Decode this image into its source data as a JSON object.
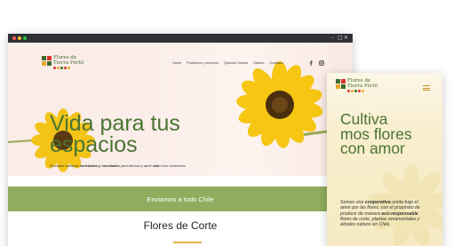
{
  "desktop": {
    "window_controls": [
      "–",
      "□",
      "✕"
    ],
    "logo": {
      "line1": "Flores de",
      "line2": "Tierra Fértil"
    },
    "nav": [
      "Home",
      "Productos y servicios",
      "Quienes Somos",
      "Galería",
      "Contacto"
    ],
    "social_icons": [
      "facebook-icon",
      "instagram-icon"
    ],
    "hero": {
      "title": "Vida para tus espacios",
      "subtitle_parts": [
        "Descubre nuestras ",
        "variedades y novedades",
        " para decorar y darle ",
        "vida",
        " a tus creaciones"
      ]
    },
    "band_text": "Enviamos a todo Chile",
    "section_title": "Flores de Corte"
  },
  "mobile": {
    "logo": {
      "line1": "Flores de",
      "line2": "Tierra Fértil"
    },
    "title": "Cultiva mos flores con amor",
    "text_parts": [
      "Somos una ",
      "cooperativa",
      " unida bajo el amor por las flores, con el propósito de producir de manera ",
      "eco-responsable",
      " flores de corte, plantas ornamentales y árboles nativos en Chile."
    ]
  },
  "colors": {
    "brand_green": "#4a7433",
    "band_green": "#8fad5f",
    "accent_gold": "#e8b44a",
    "chrome": "#2f3136"
  }
}
